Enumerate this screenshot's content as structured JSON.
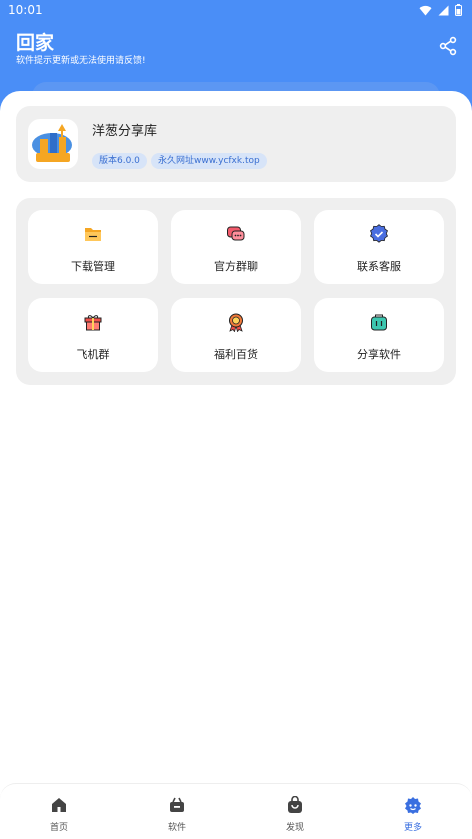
{
  "status_bar": {
    "time": "10:01"
  },
  "header": {
    "title": "回家",
    "subtitle": "软件提示更新或无法使用请反馈!",
    "share_icon": "share-icon"
  },
  "app_card": {
    "logo_icon": "app-logo",
    "name": "洋葱分享库",
    "version_badge": "版本6.0.0",
    "site_badge": "永久网址www.ycfxk.top"
  },
  "menu": {
    "items": [
      {
        "label": "下载管理",
        "icon": "folder-icon",
        "color": "#f5a623"
      },
      {
        "label": "官方群聊",
        "icon": "chat-icon",
        "color": "#f25a6b"
      },
      {
        "label": "联系客服",
        "icon": "verified-icon",
        "color": "#4a6ee0"
      },
      {
        "label": "飞机群",
        "icon": "gift-icon",
        "color": "#f2504b"
      },
      {
        "label": "福利百货",
        "icon": "medal-icon",
        "color": "#f07a3b"
      },
      {
        "label": "分享软件",
        "icon": "bag-icon",
        "color": "#3cc7b0"
      }
    ]
  },
  "bottom_nav": {
    "active_color": "#3a6fe0",
    "items": [
      {
        "label": "首页",
        "icon": "home-icon"
      },
      {
        "label": "软件",
        "icon": "apps-icon"
      },
      {
        "label": "发现",
        "icon": "discover-bag-icon"
      },
      {
        "label": "更多",
        "icon": "more-icon"
      }
    ]
  }
}
